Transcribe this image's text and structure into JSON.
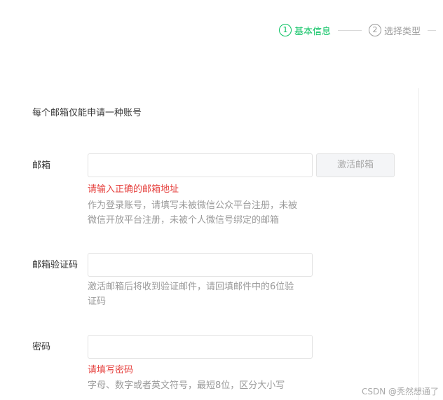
{
  "steps": [
    {
      "number": "1",
      "label": "基本信息"
    },
    {
      "number": "2",
      "label": "选择类型"
    }
  ],
  "notice": "每个邮箱仅能申请一种账号",
  "email": {
    "label": "邮箱",
    "value": "",
    "button_label": "激活邮箱",
    "error": "请输入正确的邮箱地址",
    "tip": "作为登录账号，请填写未被微信公众平台注册，未被微信开放平台注册，未被个人微信号绑定的邮箱"
  },
  "verify_code": {
    "label": "邮箱验证码",
    "value": "",
    "tip": "激活邮箱后将收到验证邮件，请回填邮件中的6位验证码"
  },
  "password": {
    "label": "密码",
    "value": "",
    "error": "请填写密码",
    "tip": "字母、数字或者英文符号，最短8位，区分大小写"
  },
  "watermark": "CSDN @秃然想通了",
  "colors": {
    "accent": "#07c160",
    "error": "#e64340",
    "muted": "#9a9a9a"
  }
}
